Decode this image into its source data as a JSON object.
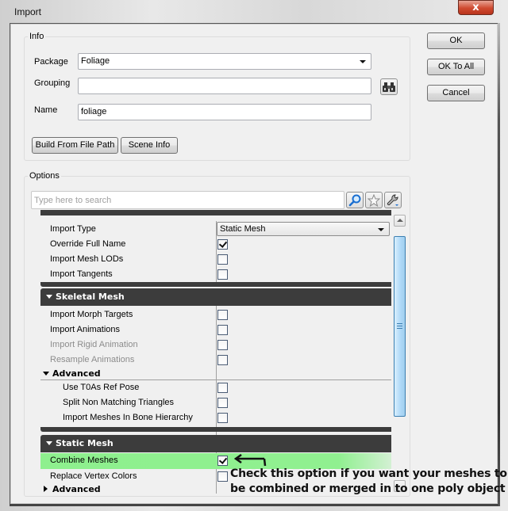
{
  "window": {
    "title": "Import",
    "close_glyph": "x"
  },
  "dialog_buttons": {
    "ok": "OK",
    "ok_to_all": "OK To All",
    "cancel": "Cancel"
  },
  "info": {
    "group_label": "Info",
    "package_label": "Package",
    "package_value": "Foliage",
    "grouping_label": "Grouping",
    "grouping_value": "",
    "name_label": "Name",
    "name_value": "foliage",
    "build_from_file_path": "Build From File Path",
    "scene_info": "Scene Info",
    "browse_icon": "binoculars-icon"
  },
  "options": {
    "group_label": "Options",
    "search_placeholder": "Type here to search",
    "search_icons": [
      "magnifier-icon",
      "star-icon",
      "wrench-icon"
    ],
    "general": {
      "rows": [
        {
          "label": "Import Type",
          "type": "combo",
          "value": "Static Mesh"
        },
        {
          "label": "Override Full Name",
          "type": "checkbox",
          "checked": true
        },
        {
          "label": "Import Mesh LODs",
          "type": "checkbox",
          "checked": false
        },
        {
          "label": "Import Tangents",
          "type": "checkbox",
          "checked": false
        }
      ]
    },
    "skeletal_mesh": {
      "title": "Skeletal Mesh",
      "rows": [
        {
          "label": "Import Morph Targets",
          "checked": false,
          "enabled": true
        },
        {
          "label": "Import Animations",
          "checked": false,
          "enabled": true
        },
        {
          "label": "Import Rigid Animation",
          "checked": false,
          "enabled": false
        },
        {
          "label": "Resample Animations",
          "checked": false,
          "enabled": false
        }
      ],
      "advanced": {
        "title": "Advanced",
        "rows": [
          {
            "label": "Use T0As Ref Pose",
            "checked": false
          },
          {
            "label": "Split Non Matching Triangles",
            "checked": false
          },
          {
            "label": "Import Meshes In Bone Hierarchy",
            "checked": false
          }
        ]
      }
    },
    "static_mesh": {
      "title": "Static Mesh",
      "rows": [
        {
          "label": "Combine Meshes",
          "checked": true,
          "highlighted": true
        },
        {
          "label": "Replace Vertex Colors",
          "checked": false
        }
      ],
      "advanced_title": "Advanced"
    }
  },
  "annotation": {
    "line1": "Check this option if you want your meshes to",
    "line2": "be combined or merged in to one poly object",
    "highlight_color": "#90f090"
  }
}
